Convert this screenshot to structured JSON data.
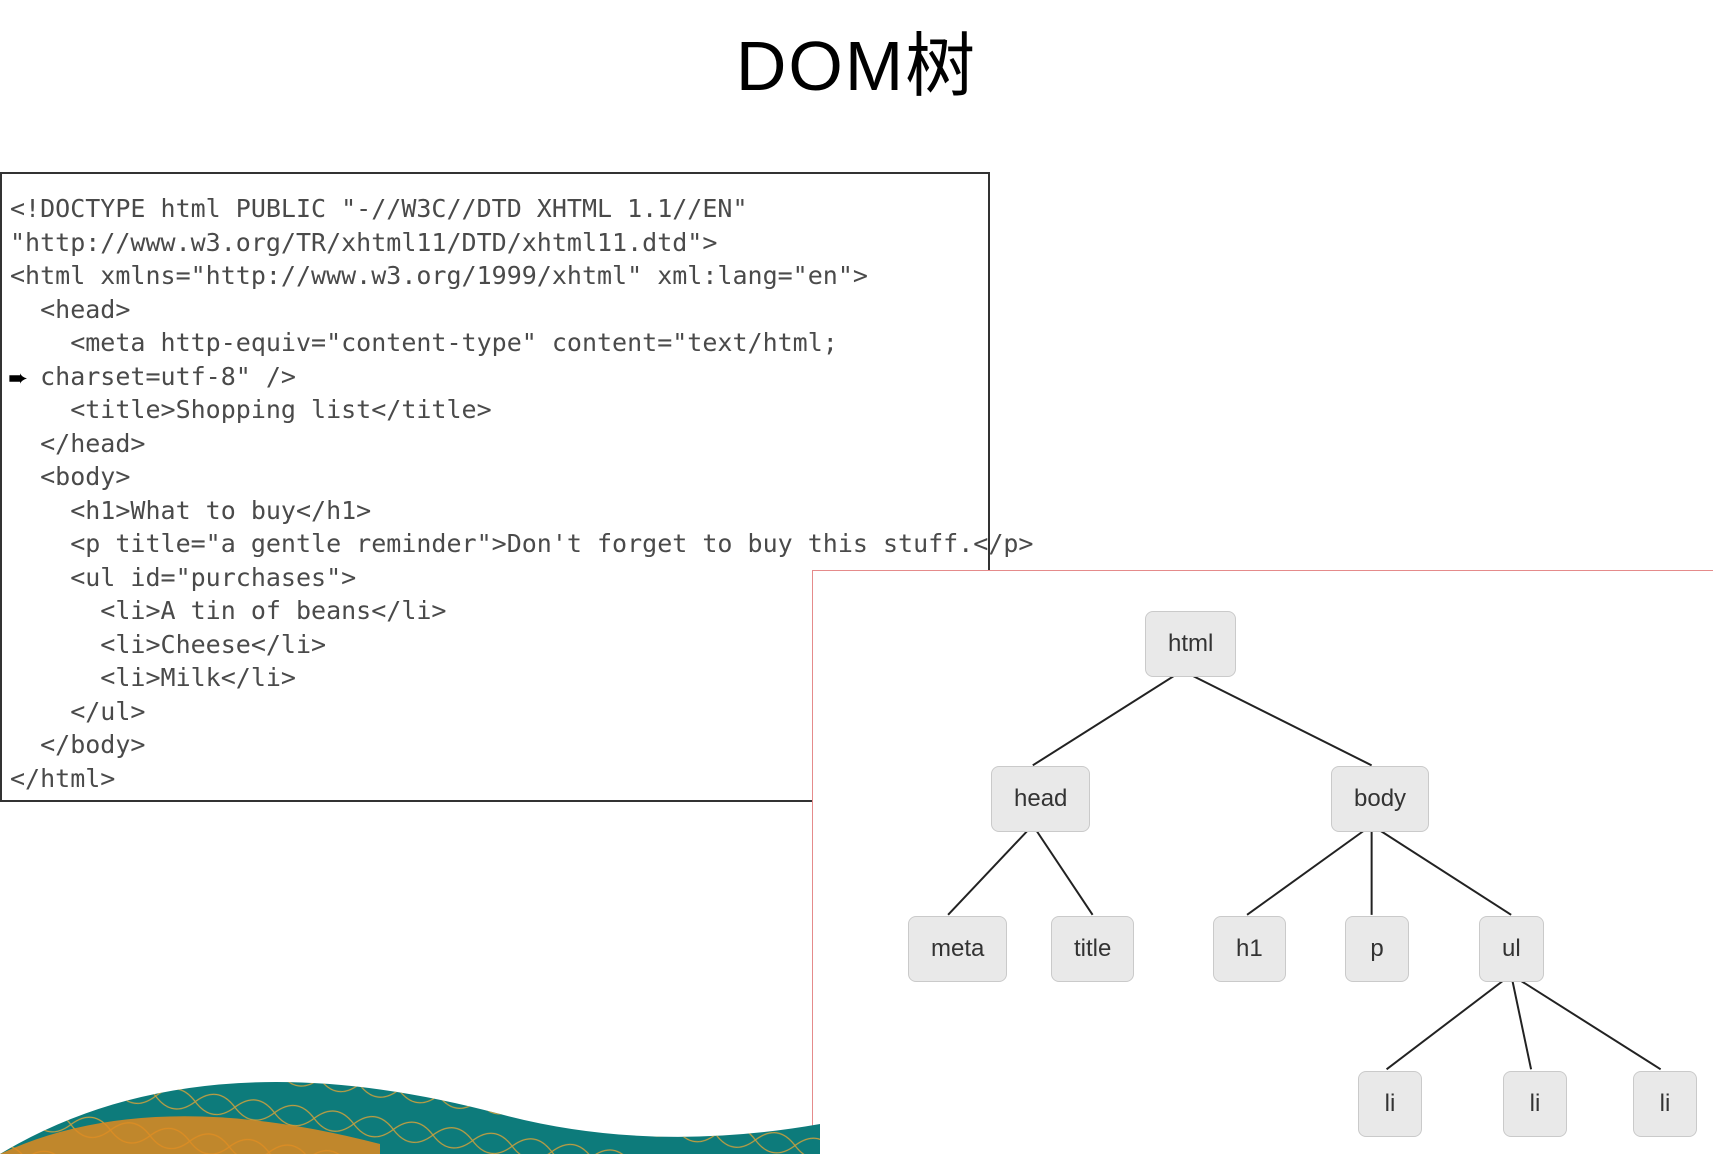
{
  "title": "DOM树",
  "code_lines": [
    "<!DOCTYPE html PUBLIC \"-//W3C//DTD XHTML 1.1//EN\"",
    "\"http://www.w3.org/TR/xhtml11/DTD/xhtml11.dtd\">",
    "<html xmlns=\"http://www.w3.org/1999/xhtml\" xml:lang=\"en\">",
    "  <head>",
    "    <meta http-equiv=\"content-type\" content=\"text/html;",
    "  charset=utf-8\" />",
    "    <title>Shopping list</title>",
    "  </head>",
    "  <body>",
    "    <h1>What to buy</h1>",
    "    <p title=\"a gentle reminder\">Don't forget to buy this stuff.</p>",
    "    <ul id=\"purchases\">",
    "      <li>A tin of beans</li>",
    "      <li>Cheese</li>",
    "      <li>Milk</li>",
    "    </ul>",
    "  </body>",
    "</html>"
  ],
  "tree": {
    "root": "html",
    "head": "head",
    "body": "body",
    "meta": "meta",
    "title_node": "title",
    "h1": "h1",
    "p": "p",
    "ul": "ul",
    "li1": "li",
    "li2": "li",
    "li3": "li"
  }
}
